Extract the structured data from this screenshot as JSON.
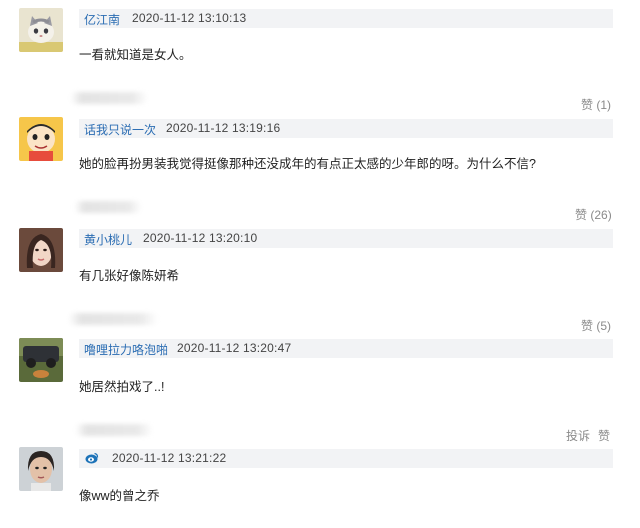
{
  "comments": [
    {
      "avatar": "cat-avatar",
      "username": "亿江南",
      "time": "2020-11-12 13:10:13",
      "text": "一看就知道是女人。",
      "like_label": "赞",
      "like_count": "(1)"
    },
    {
      "avatar": "cartoon-avatar",
      "username": "话我只说一次",
      "time": "2020-11-12 13:19:16",
      "text": "她的脸再扮男装我觉得挺像那种还没成年的有点正太感的少年郎的呀。为什么不信?",
      "like_label": "赞",
      "like_count": "(26)"
    },
    {
      "avatar": "girl-avatar",
      "username": "黄小桃儿",
      "time": "2020-11-12 13:20:10",
      "text": "有几张好像陈妍希",
      "like_label": "赞",
      "like_count": "(5)"
    },
    {
      "avatar": "car-avatar",
      "username": "噜哩拉力咯泡啪",
      "time": "2020-11-12 13:20:47",
      "text": "她居然拍戏了..!",
      "report_label": "投诉",
      "like_label": "赞"
    },
    {
      "avatar": "woman-avatar",
      "username": "",
      "time": "2020-11-12 13:21:22",
      "text": "像ww的曾之乔"
    }
  ],
  "colors": {
    "username": "#2b6db3",
    "meta_bar": "#f2f3f5",
    "action_text": "#8a8a8a"
  }
}
